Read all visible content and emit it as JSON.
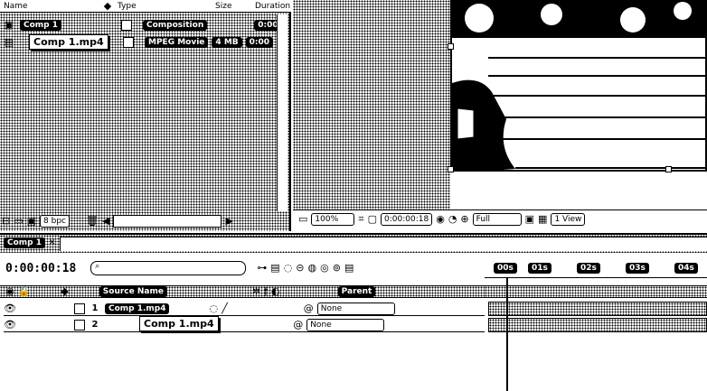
{
  "project": {
    "columns": [
      "Name",
      "Type",
      "Size",
      "Duration"
    ],
    "rows": [
      {
        "name": "Comp 1",
        "type": "Composition",
        "size": "",
        "duration": "0:00"
      },
      {
        "name": "Comp 1.mp4",
        "type": "MPEG Movie",
        "size": "4 MB",
        "duration": "0:00"
      }
    ],
    "tooltip": "Comp 1.mp4",
    "bpc": "8 bpc"
  },
  "viewer": {
    "zoom": "100%",
    "timecode": "0:00:00:18",
    "resolution": "Full",
    "view": "1 View"
  },
  "timeline": {
    "tab": "Comp 1",
    "timecode": "0:00:00:18",
    "search_placeholder": "",
    "header": {
      "layer_name": "Source Name",
      "parent": "Parent"
    },
    "layers": [
      {
        "index": "1",
        "name": "Comp 1.mp4",
        "parent": "None"
      },
      {
        "index": "2",
        "name": "Comp 1.mp4",
        "parent": "None"
      }
    ],
    "tooltip": "Comp 1.mp4",
    "ruler": [
      "00s",
      "01s",
      "02s",
      "03s",
      "04s"
    ]
  }
}
